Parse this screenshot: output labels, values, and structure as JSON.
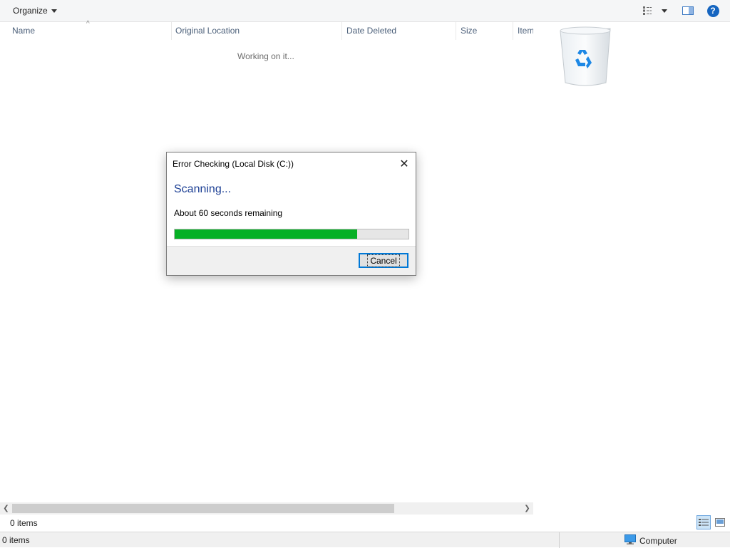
{
  "toolbar": {
    "organize_label": "Organize",
    "icons": [
      "view-options-icon",
      "dropdown-caret-icon",
      "preview-pane-icon",
      "help-icon"
    ],
    "help_symbol": "?"
  },
  "columns": [
    "Name",
    "Original Location",
    "Date Deleted",
    "Size",
    "Item"
  ],
  "working_text": "Working on it...",
  "dialog": {
    "title": "Error Checking (Local Disk (C:))",
    "heading": "Scanning...",
    "subtext": "About 60 seconds remaining",
    "progress": 0.78,
    "cancel_label": "Cancel",
    "close_symbol": "✕"
  },
  "status": {
    "inner_items": "0 items",
    "bar_items": "0 items",
    "location": "Computer"
  },
  "colors": {
    "progress_fill": "#06b025",
    "heading": "#1c3f94",
    "help": "#1565c0",
    "bin_arrows": "#1e88e5"
  }
}
